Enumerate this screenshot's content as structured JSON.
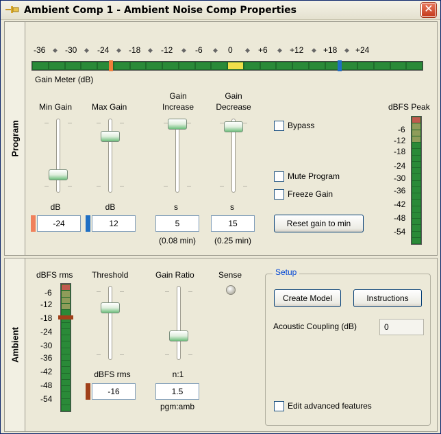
{
  "window": {
    "title": "Ambient Comp 1 - Ambient Noise Comp Properties",
    "close_glyph": "✕",
    "pin_icon": "pin-icon"
  },
  "program": {
    "tab_label": "Program",
    "gain_meter": {
      "scale": [
        "-36",
        "◆",
        "-30",
        "◆",
        "-24",
        "◆",
        "-18",
        "◆",
        "-12",
        "◆",
        "-6",
        "◆",
        "0",
        "◆",
        "+6",
        "◆",
        "+12",
        "◆",
        "+18",
        "◆",
        "+24"
      ],
      "label": "Gain Meter (dB)",
      "marker_orange_color": "#f07f3c",
      "marker_blue_color": "#1f6fc4",
      "level_yellow_color": "#f0e04a"
    },
    "sliders": {
      "min_gain": {
        "header": "Min Gain",
        "unit": "dB",
        "value": "-24",
        "swatch_color": "#f0815c"
      },
      "max_gain": {
        "header": "Max Gain",
        "unit": "dB",
        "value": "12",
        "swatch_color": "#1f6fc4"
      },
      "gain_increase": {
        "header_line1": "Gain",
        "header_line2": "Increase",
        "unit": "s",
        "value": "5",
        "note": "(0.08 min)"
      },
      "gain_decrease": {
        "header_line1": "Gain",
        "header_line2": "Decrease",
        "unit": "s",
        "value": "15",
        "note": "(0.25 min)"
      }
    },
    "checkboxes": {
      "bypass": "Bypass",
      "mute_program": "Mute Program",
      "freeze_gain": "Freeze Gain"
    },
    "reset_button": "Reset gain to min",
    "peak_meter": {
      "header": "dBFS Peak",
      "scale": [
        "-6",
        "-12",
        "-18",
        "-24",
        "-30",
        "-36",
        "-42",
        "-48",
        "-54"
      ]
    }
  },
  "ambient": {
    "tab_label": "Ambient",
    "rms_meter": {
      "header": "dBFS rms",
      "scale": [
        "-6",
        "-12",
        "-18",
        "-24",
        "-30",
        "-36",
        "-42",
        "-48",
        "-54"
      ],
      "marker_color": "#a0401a"
    },
    "threshold": {
      "header": "Threshold",
      "unit": "dBFS rms",
      "value": "-16",
      "swatch_color": "#a0401a"
    },
    "gain_ratio": {
      "header": "Gain Ratio",
      "unit": "n:1",
      "value": "1.5",
      "note": "pgm:amb"
    },
    "sense": {
      "header": "Sense"
    },
    "setup": {
      "title": "Setup",
      "create_model": "Create Model",
      "instructions": "Instructions",
      "acoustic_label": "Acoustic Coupling (dB)",
      "acoustic_value": "0",
      "edit_advanced": "Edit advanced features"
    }
  }
}
